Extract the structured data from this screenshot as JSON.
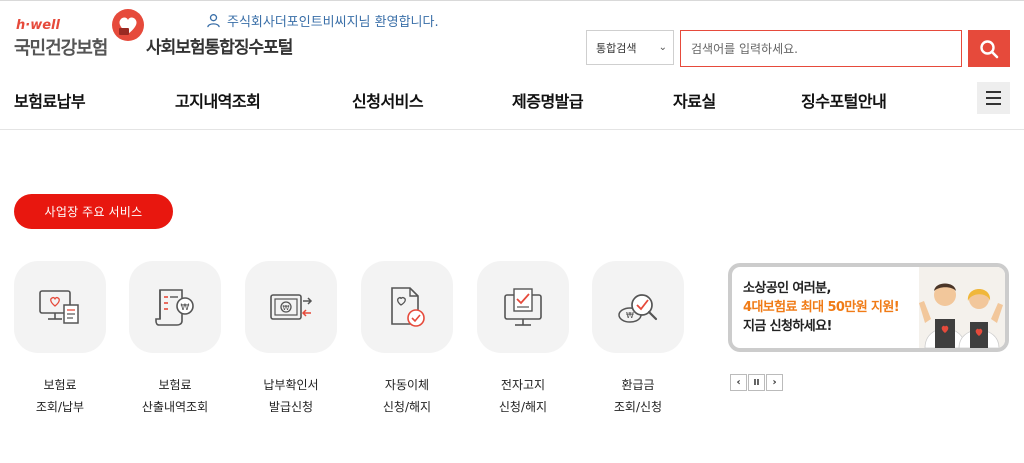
{
  "brand": {
    "logo_en": "h·well",
    "logo_ko": "국민건강보험",
    "portal_title": "사회보험통합징수포털",
    "accent_color": "#e64a3b"
  },
  "header": {
    "welcome_text": "주식회사더포인트비씨지님 환영합니다.",
    "user_icon": "user-icon",
    "search_scope": "통합검색",
    "search_placeholder": "검색어를 입력하세요.",
    "search_icon": "search-icon"
  },
  "nav": {
    "items": [
      "보험료납부",
      "고지내역조회",
      "신청서비스",
      "제증명발급",
      "자료실",
      "징수포털안내"
    ],
    "menu_icon": "hamburger-icon"
  },
  "main": {
    "section_button": "사업장 주요 서비스",
    "services": [
      {
        "line1": "보험료",
        "line2": "조회/납부",
        "icon": "monitor-bill-icon"
      },
      {
        "line1": "보험료",
        "line2": "산출내역조회",
        "icon": "calculation-document-icon"
      },
      {
        "line1": "납부확인서",
        "line2": "발급신청",
        "icon": "payment-certificate-icon"
      },
      {
        "line1": "자동이체",
        "line2": "신청/해지",
        "icon": "auto-transfer-icon"
      },
      {
        "line1": "전자고지",
        "line2": "신청/해지",
        "icon": "electronic-notice-icon"
      },
      {
        "line1": "환급금",
        "line2": "조회/신청",
        "icon": "refund-search-icon"
      }
    ]
  },
  "banner": {
    "line1": "소상공인 여러분,",
    "line2": "4대보험료 최대 50만원 지원!",
    "line3": "지금 신청하세요!",
    "highlight_color": "#f07b16",
    "controls": {
      "prev": "‹",
      "pause": "II",
      "next": "›"
    }
  }
}
